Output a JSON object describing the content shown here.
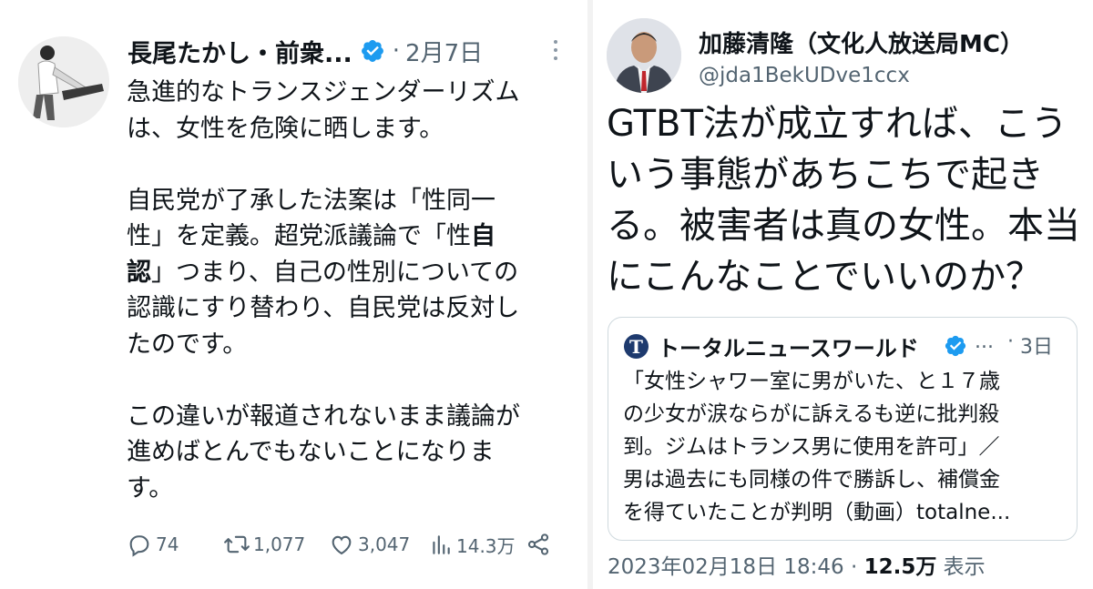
{
  "left_tweet": {
    "author_name": "長尾たかし・前衆...",
    "verified_icon": "verified-badge-icon",
    "date": "2月7日",
    "body_lines": [
      [
        {
          "t": "急進的なトランスジェンダーリズム"
        }
      ],
      [
        {
          "t": "は、女性を危険に晒します。"
        }
      ],
      [],
      [
        {
          "t": "自民党が了承した法案は「性同一"
        }
      ],
      [
        {
          "t": "性」を定義。超党派議論で「性"
        },
        {
          "t": "自",
          "b": true
        }
      ],
      [
        {
          "t": "認",
          "b": true
        },
        {
          "t": "」つまり、自己の性別についての"
        }
      ],
      [
        {
          "t": "認識にすり替わり、自民党は反対し"
        }
      ],
      [
        {
          "t": "たのです。"
        }
      ],
      [],
      [
        {
          "t": "この違いが報道されないまま議論が"
        }
      ],
      [
        {
          "t": "進めばとんでもないことになりま"
        }
      ],
      [
        {
          "t": "す。"
        }
      ]
    ],
    "stats": {
      "replies": "74",
      "retweets": "1,077",
      "likes": "3,047",
      "views": "14.3万"
    }
  },
  "right_tweet": {
    "author_name": "加藤清隆（文化人放送局MC）",
    "handle": "@jda1BekUDve1ccx",
    "body_lines": [
      "GTBT法が成立すれば、こう",
      "いう事態があちこちで起き",
      "る。被害者は真の女性。本当",
      "にこんなことでいいのか？"
    ],
    "quoted": {
      "logo_letter": "T",
      "source_name": "トータルニュースワールド",
      "ellipsis": "...",
      "separator": "·",
      "date": "3日",
      "body_lines": [
        "「女性シャワー室に男がいた、と１７歳",
        "の少女が涙ならがに訴えるも逆に批判殺",
        "到。ジムはトランス男に使用を許可」／",
        "男は過去にも同様の件で勝訴し、補償金",
        "を得ていたことが判明（動画）totalne..."
      ]
    },
    "timestamp": "2023年02月18日 18:46",
    "separator": "·",
    "view_count": "12.5万",
    "view_label": "表示"
  },
  "colors": {
    "text": "#0f1419",
    "secondary": "#536471",
    "verified": "#1d9bf0",
    "border": "#cfd9de"
  }
}
